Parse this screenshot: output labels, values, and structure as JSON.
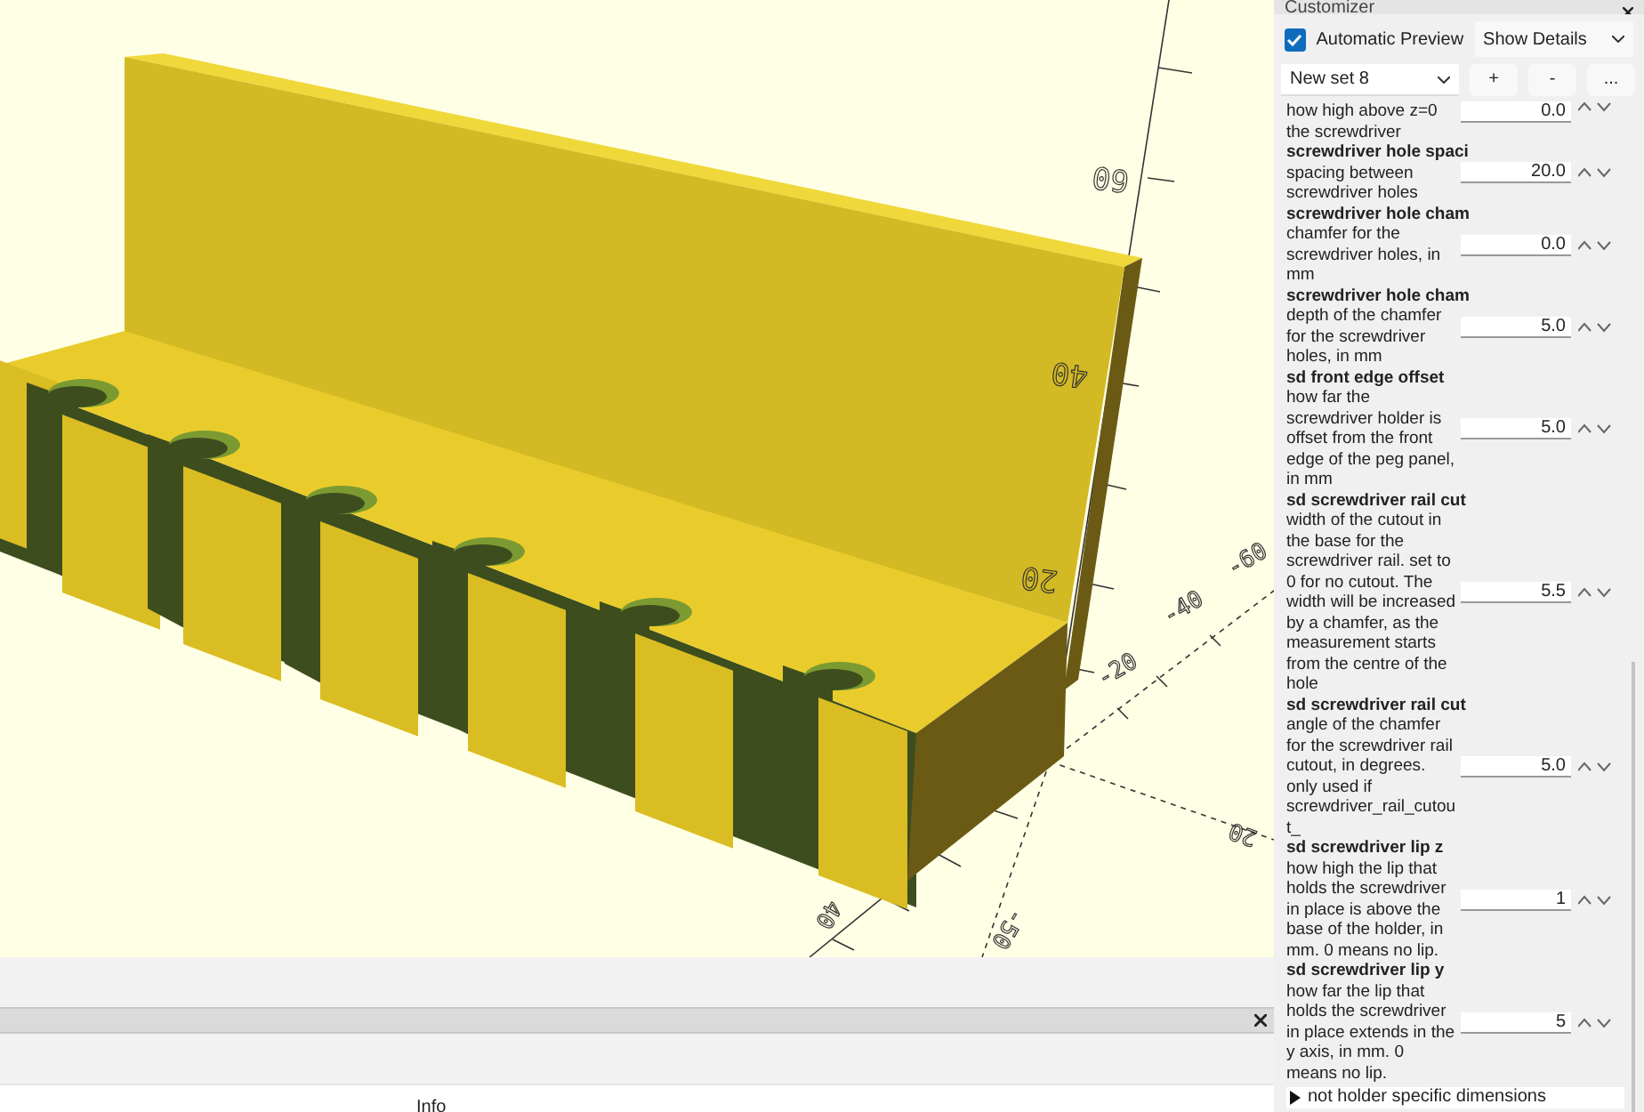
{
  "viewport": {
    "axis_labels": [
      {
        "text": "60",
        "kind": "z"
      },
      {
        "text": "40",
        "kind": "z"
      },
      {
        "text": "20",
        "kind": "z"
      },
      {
        "text": "-20",
        "kind": "y"
      },
      {
        "text": "-40",
        "kind": "y"
      },
      {
        "text": "-60",
        "kind": "y"
      },
      {
        "text": "40",
        "kind": "x"
      },
      {
        "text": "-50",
        "kind": "x"
      },
      {
        "text": "20",
        "kind": "x2"
      }
    ]
  },
  "console": {
    "tab": "Info"
  },
  "customizer": {
    "title": "Customizer",
    "automatic_preview": {
      "label": "Automatic Preview",
      "checked": true
    },
    "details_dropdown": "Show Details",
    "preset_dropdown": "New set 8",
    "preset_buttons": [
      "+",
      "-",
      "..."
    ],
    "params": [
      {
        "description": "how high above z=0 the screwdriver",
        "value": "0.0"
      },
      {
        "title": "screwdriver hole spaci",
        "description": "spacing between screwdriver holes",
        "value": "20.0"
      },
      {
        "title": "screwdriver hole cham",
        "description": "chamfer for the screwdriver holes, in mm",
        "value": "0.0"
      },
      {
        "title": "screwdriver hole cham",
        "description": "depth of the chamfer for the screwdriver holes, in mm",
        "value": "5.0"
      },
      {
        "title": "sd front edge offset",
        "description": "how far the screwdriver holder is offset from the front edge of the peg panel, in mm",
        "value": "5.0"
      },
      {
        "title": "sd screwdriver rail cut",
        "description": "width of the cutout in the base for the screwdriver rail. set to 0 for no cutout. The width will be increased by a chamfer, as the measurement starts from the centre of the hole",
        "value": "5.5"
      },
      {
        "title": "sd screwdriver rail cut",
        "description": "angle of the chamfer for the screwdriver rail cutout, in degrees. only used if screwdriver_rail_cutout_",
        "value": "5.0"
      },
      {
        "title": "sd screwdriver lip z",
        "description": "how high the lip that holds the screwdriver in place is above the base of the holder, in mm. 0 means no lip.",
        "value": "1"
      },
      {
        "title": "sd screwdriver lip y",
        "description": "how far the lip that holds the screwdriver in place extends in the y axis, in mm. 0 means no lip.",
        "value": "5"
      }
    ],
    "group": {
      "label": "not holder specific dimensions",
      "expanded": false
    }
  }
}
